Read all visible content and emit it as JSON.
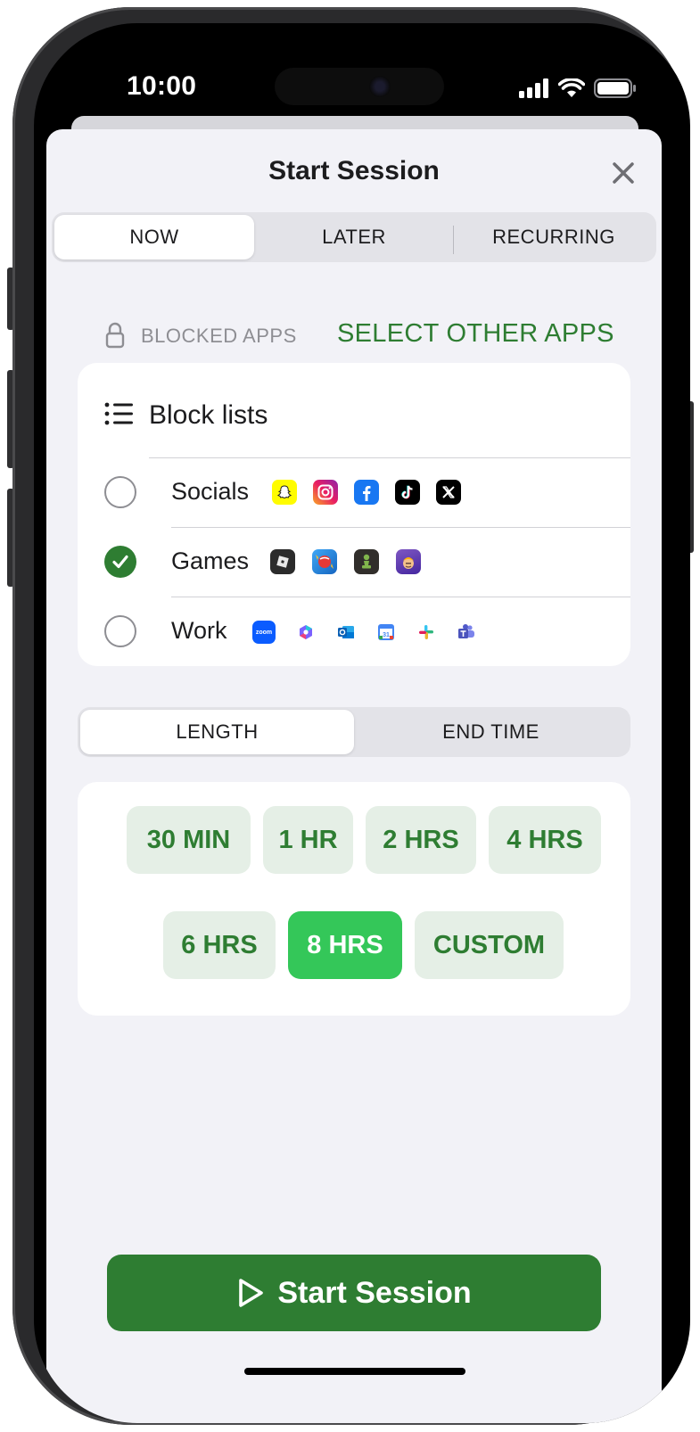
{
  "status_bar": {
    "time": "10:00"
  },
  "sheet": {
    "title": "Start Session"
  },
  "when_tabs": [
    {
      "label": "NOW",
      "active": true
    },
    {
      "label": "LATER",
      "active": false
    },
    {
      "label": "RECURRING",
      "active": false
    }
  ],
  "blocked_apps": {
    "label": "BLOCKED APPS",
    "select_link": "SELECT OTHER APPS"
  },
  "block_lists": {
    "title": "Block lists",
    "items": [
      {
        "label": "Socials",
        "checked": false,
        "apps": [
          "snapchat-icon",
          "instagram-icon",
          "facebook-icon",
          "tiktok-icon",
          "x-icon"
        ]
      },
      {
        "label": "Games",
        "checked": true,
        "apps": [
          "roblox-icon",
          "candy-crush-icon",
          "chess-icon",
          "clash-of-clans-icon"
        ]
      },
      {
        "label": "Work",
        "checked": false,
        "apps": [
          "zoom-icon",
          "copilot-icon",
          "outlook-icon",
          "google-calendar-icon",
          "slack-icon",
          "teams-icon"
        ]
      }
    ]
  },
  "duration_tabs": [
    {
      "label": "LENGTH",
      "active": true
    },
    {
      "label": "END TIME",
      "active": false
    }
  ],
  "length_options": [
    {
      "label": "30 MIN",
      "selected": false
    },
    {
      "label": "1 HR",
      "selected": false
    },
    {
      "label": "2 HRS",
      "selected": false
    },
    {
      "label": "4 HRS",
      "selected": false
    },
    {
      "label": "6 HRS",
      "selected": false
    },
    {
      "label": "8 HRS",
      "selected": true
    },
    {
      "label": "CUSTOM",
      "selected": false
    }
  ],
  "start_button": {
    "label": "Start Session"
  },
  "colors": {
    "accent": "#2e7d32",
    "selected_chip": "#34c759",
    "chip_bg": "#e5efe6",
    "sheet_bg": "#f2f2f7"
  }
}
